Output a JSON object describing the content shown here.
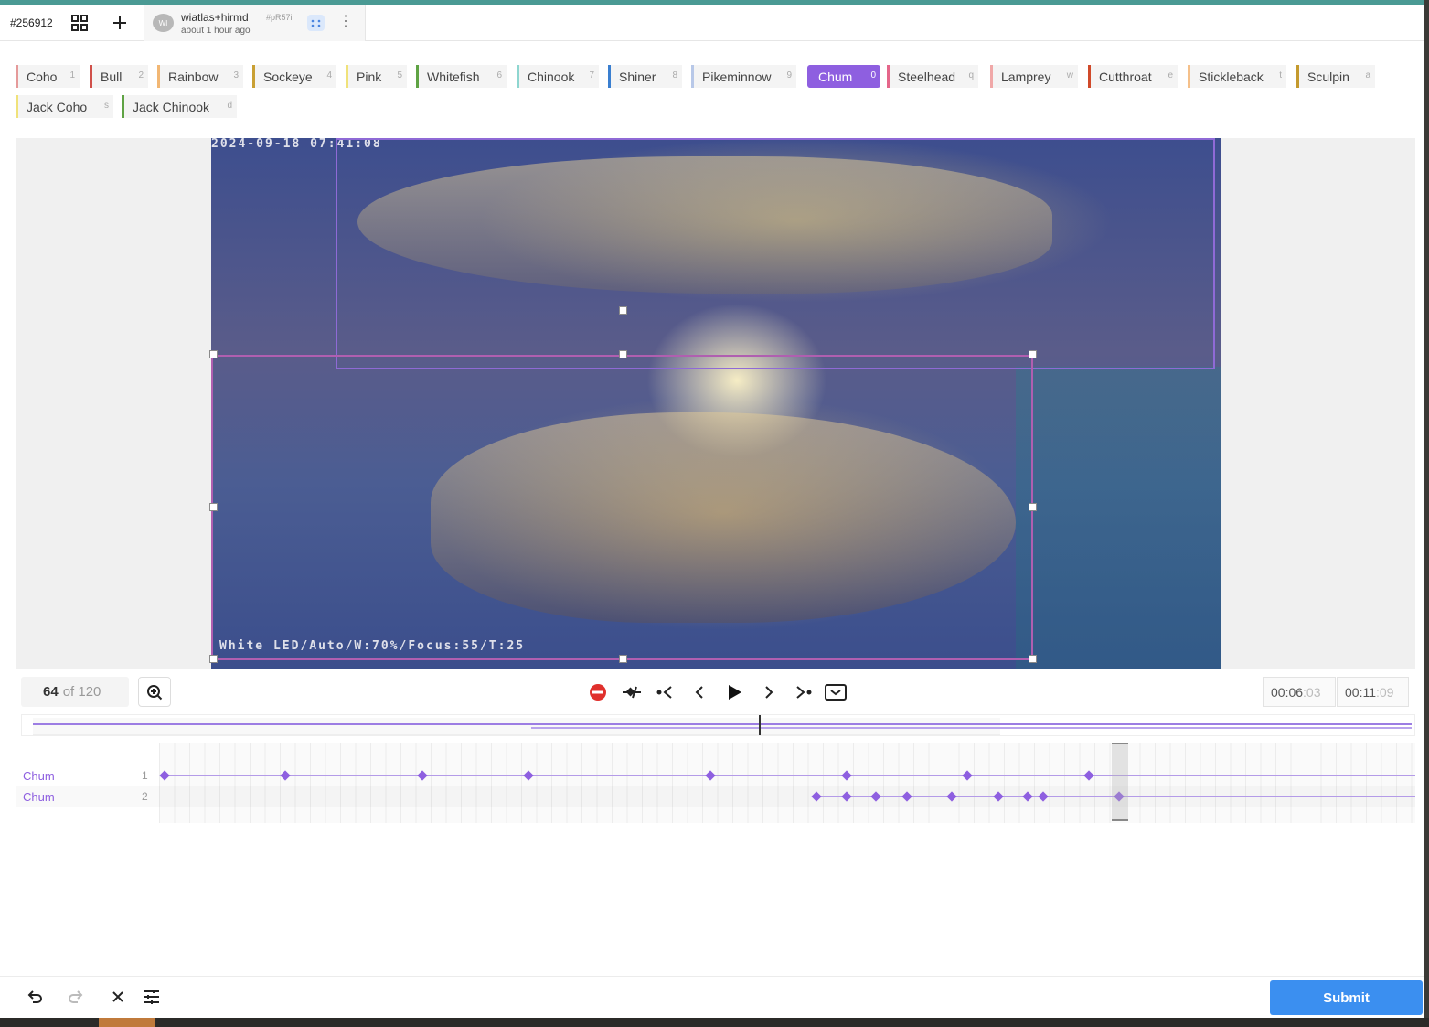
{
  "header": {
    "task_id": "#256912",
    "tab": {
      "avatar": "WI",
      "user": "wiatlas+hirmd",
      "hash": "#pR57i",
      "time": "about 1 hour ago"
    }
  },
  "labels": [
    {
      "name": "Coho",
      "hotkey": "1",
      "color": "#e59a9a"
    },
    {
      "name": "Bull",
      "hotkey": "2",
      "color": "#d0504a"
    },
    {
      "name": "Rainbow",
      "hotkey": "3",
      "color": "#f2b774"
    },
    {
      "name": "Sockeye",
      "hotkey": "4",
      "color": "#c9a034"
    },
    {
      "name": "Pink",
      "hotkey": "5",
      "color": "#f0e27a"
    },
    {
      "name": "Whitefish",
      "hotkey": "6",
      "color": "#5fa344"
    },
    {
      "name": "Chinook",
      "hotkey": "7",
      "color": "#8ed6d0"
    },
    {
      "name": "Shiner",
      "hotkey": "8",
      "color": "#3a7fd0"
    },
    {
      "name": "Pikeminnow",
      "hotkey": "9",
      "color": "#b8c8e8"
    },
    {
      "name": "Chum",
      "hotkey": "0",
      "color": "#8e5fe0",
      "active": true
    },
    {
      "name": "Steelhead",
      "hotkey": "q",
      "color": "#e5668a"
    },
    {
      "name": "Lamprey",
      "hotkey": "w",
      "color": "#f0a8a8"
    },
    {
      "name": "Cutthroat",
      "hotkey": "e",
      "color": "#d04a2a"
    },
    {
      "name": "Stickleback",
      "hotkey": "t",
      "color": "#f5c08a"
    },
    {
      "name": "Sculpin",
      "hotkey": "a",
      "color": "#c49a2e"
    },
    {
      "name": "Jack Coho",
      "hotkey": "s",
      "color": "#f0e27a"
    },
    {
      "name": "Jack Chinook",
      "hotkey": "d",
      "color": "#5fa344"
    }
  ],
  "video": {
    "timestamp_overlay": "2024-09-18 07:41:08",
    "osd_overlay": "White LED/Auto/W:70%/Focus:55/T:25"
  },
  "player": {
    "current_frame": "64",
    "of_text": "of 120",
    "time_current": "00:06",
    "time_current_ms": ":03",
    "time_total": "00:11",
    "time_total_ms": ":09",
    "progress": 0.53
  },
  "tracks": [
    {
      "label": "Chum",
      "index": "1"
    },
    {
      "label": "Chum",
      "index": "2"
    }
  ],
  "footer": {
    "submit_label": "Submit"
  }
}
